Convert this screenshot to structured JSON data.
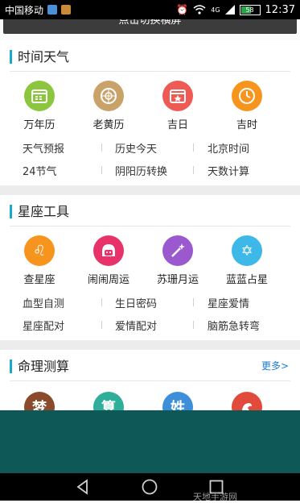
{
  "status_bar": {
    "carrier": "中国移动",
    "network": "4G",
    "battery_percent": "58",
    "time": "12:37"
  },
  "banner": {
    "text": "点击切换横屏"
  },
  "sections": [
    {
      "title": "时间天气",
      "icons": [
        {
          "label": "万年历",
          "color": "#8cc63f",
          "icon": "calendar-icon"
        },
        {
          "label": "老黄历",
          "color": "#c9a26a",
          "icon": "compass-icon"
        },
        {
          "label": "吉日",
          "color": "#ef5a55",
          "icon": "lucky-calendar-icon"
        },
        {
          "label": "吉时",
          "color": "#f7941d",
          "icon": "clock-icon"
        }
      ],
      "links": [
        [
          "天气预报",
          "历史今天",
          "北京时间"
        ],
        [
          "24节气",
          "阴阳历转换",
          "天数计算"
        ]
      ]
    },
    {
      "title": "星座工具",
      "icons": [
        {
          "label": "查星座",
          "color": "#f7941d",
          "icon": "leo-icon"
        },
        {
          "label": "闹闹周运",
          "color": "#e8336a",
          "icon": "girl-face-icon"
        },
        {
          "label": "苏珊月运",
          "color": "#9b59d0",
          "icon": "magic-wand-icon"
        },
        {
          "label": "蓝蓝占星",
          "color": "#3db8e8",
          "icon": "star-of-david-icon"
        }
      ],
      "links": [
        [
          "血型自测",
          "生日密码",
          "星座爱情"
        ],
        [
          "星座配对",
          "爱情配对",
          "脑筋急转弯"
        ]
      ]
    },
    {
      "title": "命理测算",
      "more": "更多>",
      "icons": [
        {
          "char": "梦",
          "color": "#8b4a2b",
          "icon": "dream-icon"
        },
        {
          "char": "算",
          "color": "#2fae9a",
          "icon": "calculate-icon"
        },
        {
          "char": "姓",
          "color": "#3d8fd9",
          "icon": "surname-icon"
        },
        {
          "char": "",
          "color": "#e24b3b",
          "icon": "zodiac-animal-icon"
        }
      ]
    }
  ],
  "watermark": "天地手游网"
}
